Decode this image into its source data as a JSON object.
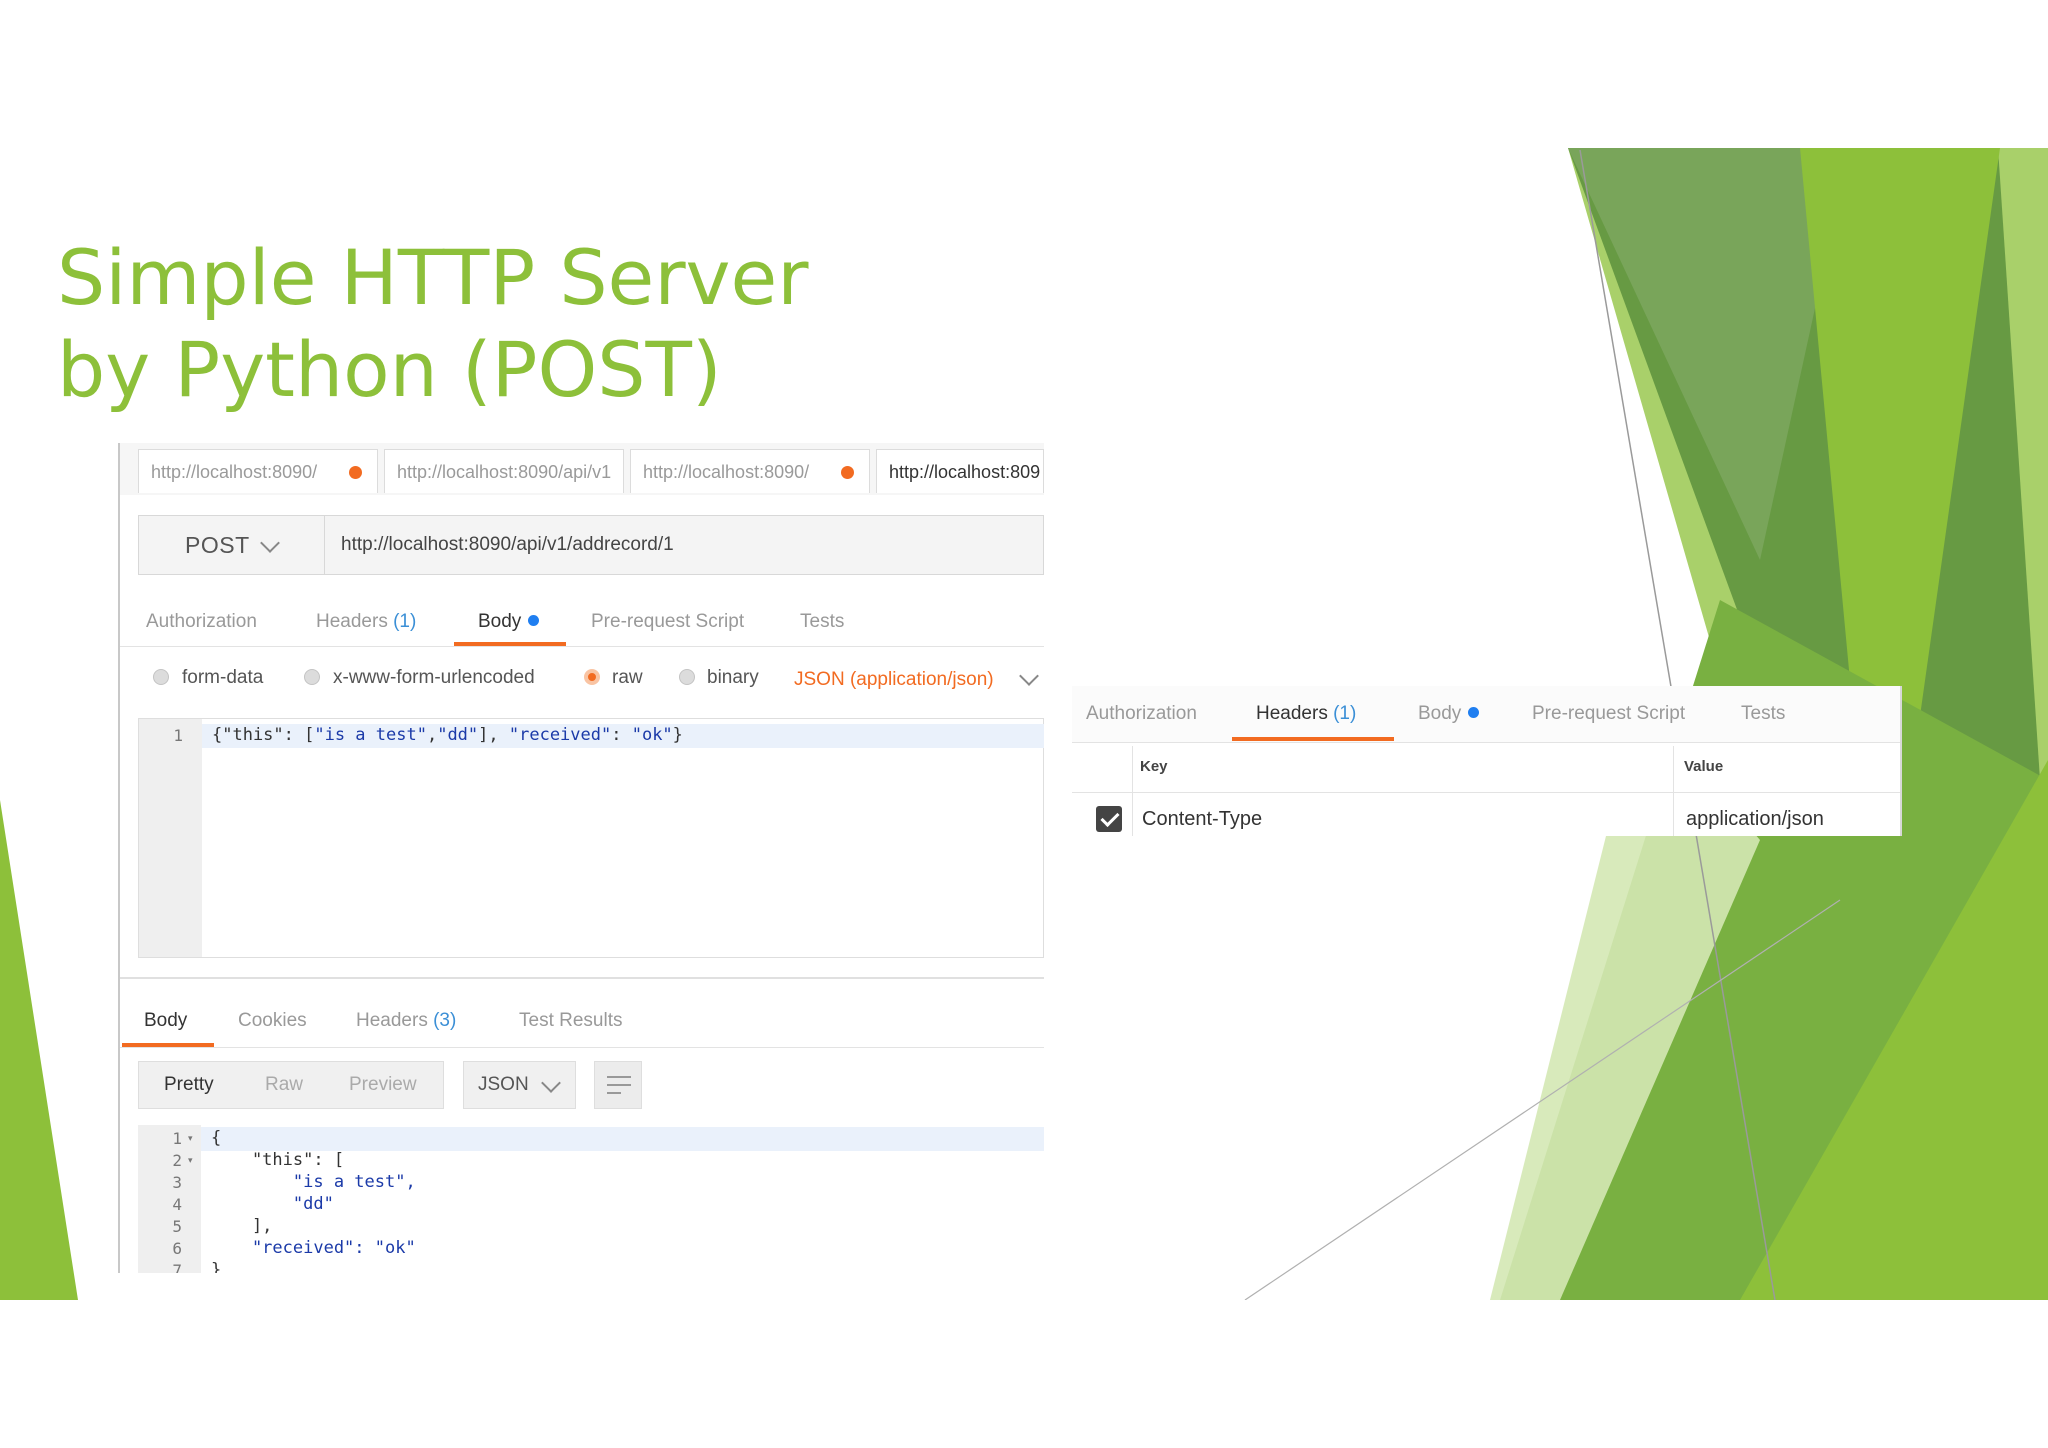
{
  "slide": {
    "title_line1": "Simple HTTP Server",
    "title_line2": "by Python (POST)",
    "accent_color": "#8dc03a"
  },
  "request": {
    "tabs": [
      {
        "label": "http://localhost:8090/",
        "unsaved": true
      },
      {
        "label": "http://localhost:8090/api/v1",
        "unsaved": false
      },
      {
        "label": "http://localhost:8090/",
        "unsaved": true
      },
      {
        "label": "http://localhost:809",
        "unsaved": false
      }
    ],
    "method": "POST",
    "url": "http://localhost:8090/api/v1/addrecord/1",
    "subtabs": {
      "authorization": "Authorization",
      "headers": "Headers",
      "headers_count": "(1)",
      "body": "Body",
      "prerequest": "Pre-request Script",
      "tests": "Tests"
    },
    "body_modes": {
      "form_data": "form-data",
      "urlencoded": "x-www-form-urlencoded",
      "raw": "raw",
      "binary": "binary",
      "selected": "raw",
      "content_type": "JSON (application/json)"
    },
    "editor": {
      "line_number": "1",
      "p1": "{\"this\": [",
      "s1": "\"is a test\"",
      "p2": ",",
      "s2": "\"dd\"",
      "p3": "], ",
      "s3": "\"received\"",
      "p4": ": ",
      "s4": "\"ok\"",
      "p5": "}"
    }
  },
  "response": {
    "tabs": {
      "body": "Body",
      "cookies": "Cookies",
      "headers": "Headers",
      "headers_count": "(3)",
      "test_results": "Test Results"
    },
    "formats": {
      "pretty": "Pretty",
      "raw": "Raw",
      "preview": "Preview"
    },
    "language": "JSON",
    "lines": [
      {
        "n": "1",
        "text": "{"
      },
      {
        "n": "2",
        "text": "    \"this\": ["
      },
      {
        "n": "3",
        "text": "        \"is a test\","
      },
      {
        "n": "4",
        "text": "        \"dd\""
      },
      {
        "n": "5",
        "text": "    ],"
      },
      {
        "n": "6",
        "text": "    \"received\": \"ok\""
      },
      {
        "n": "7",
        "text": "}"
      }
    ]
  },
  "headers_panel": {
    "tabs": {
      "authorization": "Authorization",
      "headers": "Headers",
      "headers_count": "(1)",
      "body": "Body",
      "prerequest": "Pre-request Script",
      "tests": "Tests"
    },
    "columns": {
      "key": "Key",
      "value": "Value"
    },
    "rows": [
      {
        "key": "Content-Type",
        "value": "application/json",
        "enabled": true
      }
    ]
  },
  "colors": {
    "orange": "#f26b21",
    "blue": "#1f7ef0",
    "green_light": "#8dc03a",
    "green_dark": "#5a8f3a"
  }
}
